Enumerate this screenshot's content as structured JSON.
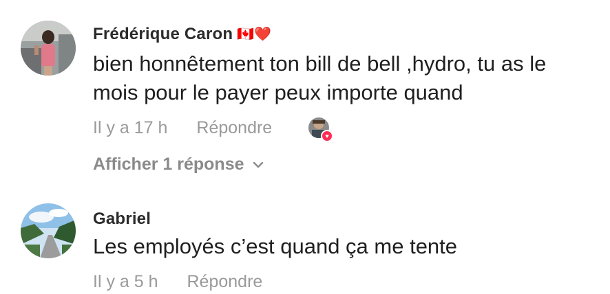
{
  "comments": [
    {
      "author": "Frédérique Caron",
      "badges": "🇨🇦❤️",
      "text": "bien honnêtement ton bill de bell ,hydro, tu as le mois pour le payer peux importe quand",
      "time": "Il y a 17 h",
      "reply_label": "Répondre",
      "view_replies": "Afficher 1 réponse",
      "liked_by_creator": true
    },
    {
      "author": "Gabriel",
      "text": "Les employés c’est quand ça me tente",
      "time": "Il y a 5 h",
      "reply_label": "Répondre"
    }
  ],
  "colors": {
    "author": "#2b2b2b",
    "text": "#1f1f1f",
    "meta": "#9a9a9a",
    "heart": "#fe2c55"
  },
  "icons": [
    "chevron-down-icon",
    "heart-icon"
  ]
}
